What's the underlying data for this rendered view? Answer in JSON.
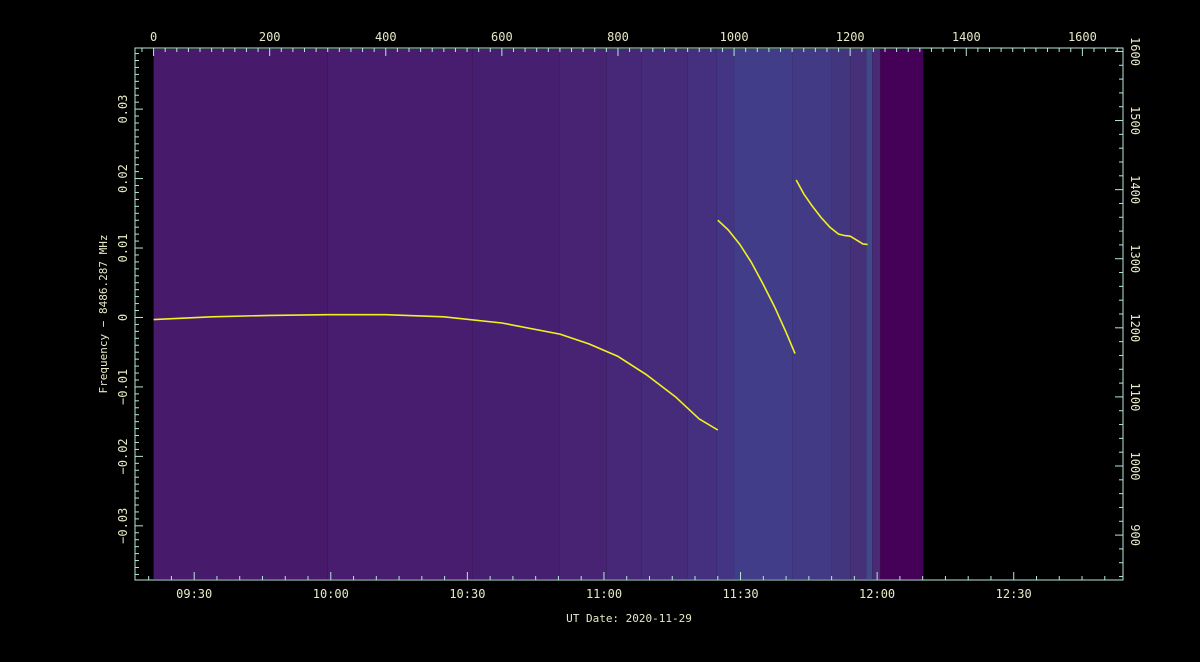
{
  "chart_data": {
    "type": "heatmap",
    "title": "",
    "xlabel": "UT Date: 2020-11-29",
    "ylabel": "Frequency − 8486.287 MHz",
    "x_bottom": {
      "unit": "UT time",
      "range": [
        "09:17",
        "12:54"
      ],
      "ticks": [
        "09:30",
        "10:00",
        "10:30",
        "11:00",
        "11:30",
        "12:00",
        "12:30"
      ]
    },
    "x_top": {
      "unit": "sample index",
      "range": [
        -32,
        1670
      ],
      "ticks": [
        "0",
        "200",
        "400",
        "600",
        "800",
        "1000",
        "1200",
        "1400",
        "1600"
      ]
    },
    "y_left": {
      "unit": "MHz offset",
      "range": [
        -0.0378,
        0.0388
      ],
      "ticks": [
        "−0.03",
        "−0.02",
        "−0.01",
        "0",
        "0.01",
        "0.02",
        "0.03"
      ]
    },
    "y_right": {
      "unit": "channel",
      "range": [
        835,
        1605
      ],
      "ticks": [
        "900",
        "1000",
        "1100",
        "1200",
        "1300",
        "1400",
        "1500",
        "1600"
      ]
    },
    "background_columns": [
      {
        "x0": 0,
        "x1": 300,
        "color": "#481a6c"
      },
      {
        "x0": 300,
        "x1": 550,
        "color": "#481c6e"
      },
      {
        "x0": 550,
        "x1": 700,
        "color": "#471f71"
      },
      {
        "x0": 700,
        "x1": 780,
        "color": "#482374"
      },
      {
        "x0": 780,
        "x1": 840,
        "color": "#472777"
      },
      {
        "x0": 840,
        "x1": 920,
        "color": "#462b7a"
      },
      {
        "x0": 920,
        "x1": 970,
        "color": "#45307f"
      },
      {
        "x0": 970,
        "x1": 1000,
        "color": "#433583"
      },
      {
        "x0": 1000,
        "x1": 1100,
        "color": "#413d88"
      },
      {
        "x0": 1100,
        "x1": 1168,
        "color": "#433a86"
      },
      {
        "x0": 1168,
        "x1": 1200,
        "color": "#42367f"
      },
      {
        "x0": 1200,
        "x1": 1228,
        "color": "#47307a"
      },
      {
        "x0": 1228,
        "x1": 1238,
        "color": "#3f4a8a"
      },
      {
        "x0": 1238,
        "x1": 1252,
        "color": "#4a2a74"
      },
      {
        "x0": 1252,
        "x1": 1326,
        "color": "#450157"
      }
    ],
    "series": [
      {
        "color": "#f2f220",
        "points": [
          [
            0,
            -0.0003
          ],
          [
            100,
            0.0001
          ],
          [
            200,
            0.0003
          ],
          [
            300,
            0.0004
          ],
          [
            400,
            0.0004
          ],
          [
            500,
            0.0001
          ],
          [
            600,
            -0.0008
          ],
          [
            700,
            -0.0024
          ],
          [
            750,
            -0.0038
          ],
          [
            800,
            -0.0056
          ],
          [
            850,
            -0.0083
          ],
          [
            900,
            -0.0115
          ],
          [
            940,
            -0.0146
          ],
          [
            972,
            -0.0162
          ]
        ]
      },
      {
        "color": "#f2f220",
        "points": [
          [
            972,
            0.014
          ],
          [
            990,
            0.0126
          ],
          [
            1010,
            0.0105
          ],
          [
            1030,
            0.0079
          ],
          [
            1050,
            0.0048
          ],
          [
            1070,
            0.0015
          ],
          [
            1090,
            -0.0022
          ],
          [
            1105,
            -0.0052
          ]
        ]
      },
      {
        "color": "#f2f220",
        "points": [
          [
            1107,
            0.0198
          ],
          [
            1120,
            0.0178
          ],
          [
            1135,
            0.016
          ],
          [
            1150,
            0.0144
          ],
          [
            1165,
            0.013
          ],
          [
            1180,
            0.012
          ],
          [
            1190,
            0.0118
          ],
          [
            1200,
            0.0117
          ],
          [
            1210,
            0.0112
          ],
          [
            1222,
            0.0106
          ],
          [
            1230,
            0.0105
          ]
        ]
      }
    ],
    "colors": {
      "axis": "#b6e8dc",
      "tick_text": "#e8e8c8",
      "outside_background": "#000000"
    }
  }
}
